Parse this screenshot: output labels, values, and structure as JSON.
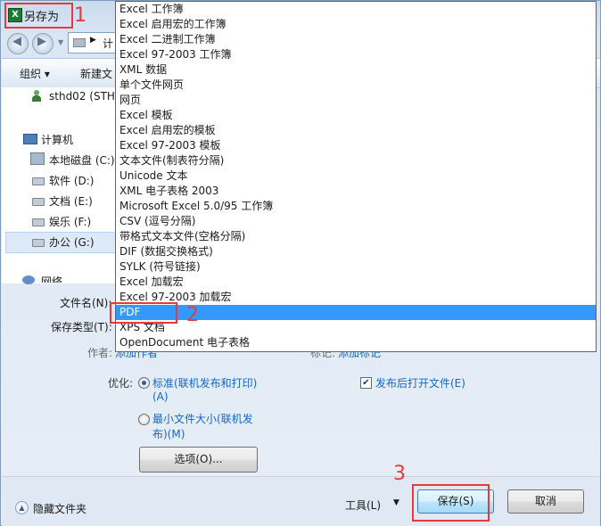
{
  "window": {
    "title": "另存为",
    "title_icon": "excel-icon"
  },
  "annotations": {
    "one": "1",
    "two": "2",
    "three": "3",
    "accent": "#e83a3a"
  },
  "nav": {
    "address_text": "计"
  },
  "toolbar": {
    "organize": "组织 ▾",
    "new_folder": "新建文"
  },
  "navpane": {
    "user": "sthd02 (STHD",
    "computer": "计算机",
    "drives": [
      "本地磁盘 (C:)",
      "软件 (D:)",
      "文档 (E:)",
      "娱乐 (F:)",
      "办公 (G:)"
    ],
    "network": "网络"
  },
  "form": {
    "filename_label": "文件名(N):",
    "savetype_label": "保存类型(T):",
    "author_label": "作者:",
    "author_value": "添加作者",
    "tags_label": "标记:",
    "tags_value": "添加标记"
  },
  "filetypes": {
    "items": [
      "Excel 工作簿",
      "Excel 启用宏的工作簿",
      "Excel 二进制工作簿",
      "Excel 97-2003 工作簿",
      "XML 数据",
      "单个文件网页",
      "网页",
      "Excel 模板",
      "Excel 启用宏的模板",
      "Excel 97-2003 模板",
      "文本文件(制表符分隔)",
      "Unicode 文本",
      "XML 电子表格 2003",
      "Microsoft Excel 5.0/95 工作簿",
      "CSV (逗号分隔)",
      "带格式文本文件(空格分隔)",
      "DIF (数据交换格式)",
      "SYLK (符号链接)",
      "Excel 加载宏",
      "Excel 97-2003 加载宏",
      "PDF",
      "XPS 文档",
      "OpenDocument 电子表格"
    ],
    "selected": "PDF"
  },
  "options": {
    "optimize_label": "优化:",
    "standard_line1": "标准(联机发布和打印)",
    "standard_line2": "(A)",
    "minimum_line1": "最小文件大小(联机发",
    "minimum_line2": "布)(M)",
    "options_button": "选项(O)...",
    "open_after": "发布后打开文件(E)",
    "open_after_checked": true,
    "standard_selected": true
  },
  "bottom": {
    "hide_folders": "隐藏文件夹",
    "tools": "工具(L)",
    "save": "保存(S)",
    "cancel": "取消"
  }
}
